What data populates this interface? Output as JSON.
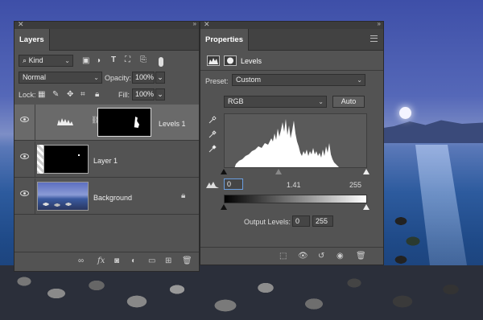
{
  "layers_panel": {
    "tab_label": "Layers",
    "filter_kind": "Kind",
    "blend_mode": "Normal",
    "opacity_label": "Opacity:",
    "opacity_value": "100%",
    "lock_label": "Lock:",
    "fill_label": "Fill:",
    "fill_value": "100%",
    "layers": [
      {
        "name": "Levels 1",
        "selected": true
      },
      {
        "name": "Layer 1",
        "selected": false
      },
      {
        "name": "Background",
        "selected": false
      }
    ]
  },
  "properties_panel": {
    "tab_label": "Properties",
    "adjustment_name": "Levels",
    "preset_label": "Preset:",
    "preset_value": "Custom",
    "channel_value": "RGB",
    "auto_label": "Auto",
    "input_black": "0",
    "input_gamma": "1.41",
    "input_white": "255",
    "output_label": "Output Levels:",
    "output_black": "0",
    "output_white": "255"
  },
  "colors": {
    "panel_bg": "#535353",
    "panel_dark": "#424242",
    "selected_layer": "#6a6a6a"
  }
}
